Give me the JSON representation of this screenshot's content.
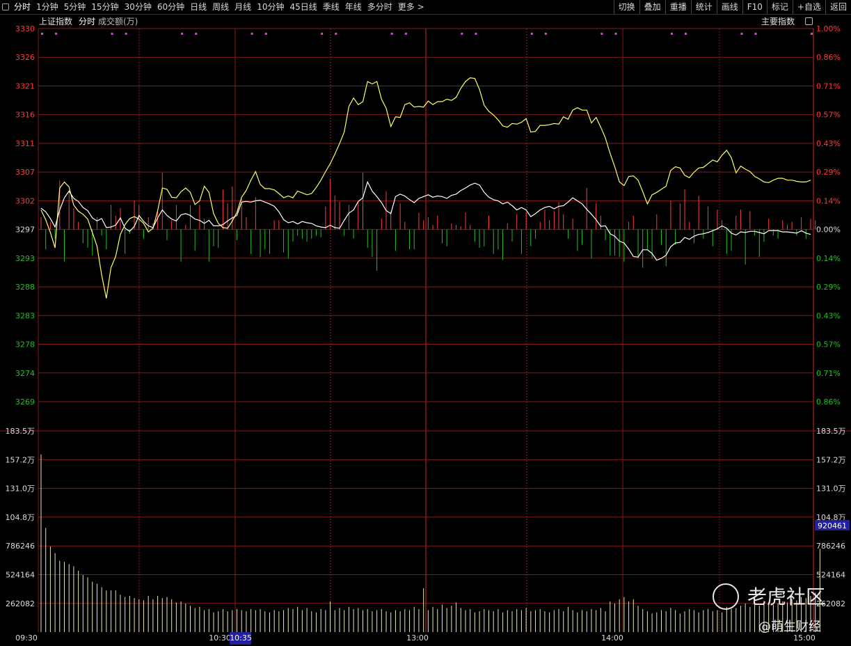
{
  "toolbar": {
    "left": [
      "分时",
      "1分钟",
      "5分钟",
      "15分钟",
      "30分钟",
      "60分钟",
      "日线",
      "周线",
      "月线",
      "10分钟",
      "45日线",
      "季线",
      "年线",
      "多分时",
      "更多 >"
    ],
    "right": [
      "切换",
      "叠加",
      "重播",
      "统计",
      "画线",
      "F10",
      "标记",
      "+自选",
      "返回"
    ]
  },
  "header": {
    "index_name": "上证指数",
    "mode": "分时",
    "volume_label": "成交额(万)",
    "main_index_button": "主要指数"
  },
  "colors": {
    "up": "#ff3b3b",
    "down": "#22c022",
    "grid": "#8a1a1a",
    "price": "#ffffff",
    "avg": "#ffff66",
    "signal": "#e040e0",
    "volume": "#e6e6b0",
    "highlight": "#2020a0"
  },
  "watermark": {
    "brand": "老虎社区",
    "author": "@萌生财经"
  },
  "chart_data": {
    "type": "line",
    "base_price": 3297,
    "price_axis": {
      "labels": [
        "3330",
        "3326",
        "3321",
        "3316",
        "3311",
        "3307",
        "3302",
        "3297",
        "3293",
        "3288",
        "3283",
        "3278",
        "3274",
        "3269"
      ],
      "pct": [
        "1.00%",
        "0.86%",
        "0.71%",
        "0.57%",
        "0.43%",
        "0.29%",
        "0.14%",
        "0.00%",
        "0.14%",
        "0.29%",
        "0.43%",
        "0.57%",
        "0.71%",
        "0.86%"
      ],
      "ylim": [
        3269,
        3330
      ]
    },
    "volume_axis": {
      "labels": [
        "183.5万",
        "157.2万",
        "131.0万",
        "104.8万",
        "786246",
        "524164",
        "262082"
      ],
      "ylim": [
        0,
        1835000
      ],
      "current_label": "920461"
    },
    "x_ticks": [
      "09:30",
      "10:30",
      "13:00",
      "14:00",
      "15:00"
    ],
    "cursor_time": "10:35",
    "series": [
      {
        "values": [
          3300.2,
          3298.6,
          3296.5,
          3294,
          3303.8,
          3304.8,
          3304,
          3301,
          3300,
          3299.5,
          3298.7,
          3296.5,
          3294.3,
          3289.6,
          3285.8,
          3290.8,
          3292.6,
          3296.2,
          3297.8,
          3298.8,
          3299.1,
          3298.7,
          3298,
          3296.6,
          3297.2,
          3300.1,
          3303.8,
          3303.6,
          3302.3,
          3302.2,
          3303.2,
          3303.8,
          3303.1,
          3301.1,
          3301.7,
          3304.1,
          3303.1,
          3299.6,
          3298,
          3297.3,
          3297.2,
          3298.4,
          3299.8,
          3302.3,
          3303.4,
          3305.1,
          3306.5,
          3304.4,
          3303.7,
          3303.7,
          3303.5,
          3302.9,
          3302.2,
          3302.5,
          3302.2,
          3303.3,
          3303,
          3302.7,
          3302.9,
          3303.9,
          3305.1,
          3306.5,
          3307.8,
          3309.4,
          3311.1,
          3313,
          3317.2,
          3318.6,
          3317.5,
          3318,
          3321.3,
          3320.9,
          3321.3,
          3318.4,
          3316.9,
          3313.9,
          3315.5,
          3315.4,
          3317.5,
          3317.8,
          3317.1,
          3317.2,
          3317.1,
          3318.1,
          3317.5,
          3318,
          3318,
          3318.4,
          3318.2,
          3318.7,
          3320.2,
          3321.3,
          3321.9,
          3321.8,
          3320,
          3317.4,
          3316.4,
          3315.8,
          3315,
          3314,
          3313.8,
          3314.4,
          3314.3,
          3314.6,
          3315.2,
          3313,
          3313.1,
          3314.1,
          3314.1,
          3314.2,
          3314.4,
          3314.3,
          3315.5,
          3315.1,
          3316.6,
          3317,
          3316.6,
          3316.6,
          3314.5,
          3315.4,
          3313.8,
          3312,
          3309.5,
          3307.3,
          3304.8,
          3304.2,
          3305.7,
          3305.8,
          3305.1,
          3303.2,
          3301.2,
          3302.7,
          3303.1,
          3303.6,
          3304.1,
          3306.7,
          3307.3,
          3307.1,
          3305.9,
          3305.5,
          3306.4,
          3307.1,
          3307.2,
          3307.8,
          3308.4,
          3308.1,
          3309.2,
          3310,
          3308.8,
          3306.3,
          3307.4,
          3306.9,
          3306.5,
          3305.7,
          3305.3,
          3304.8,
          3304.7,
          3305.1,
          3305.4,
          3305.4,
          3305.1,
          3305.1,
          3304.9,
          3304.8,
          3304.8,
          3305.1
        ]
      },
      {
        "values": [
          3300.5,
          3299.9,
          3298.8,
          3297.4,
          3300.2,
          3302.2,
          3303.3,
          3302.1,
          3301.6,
          3300.6,
          3300.1,
          3298.9,
          3298.4,
          3298.8,
          3297.3,
          3297.4,
          3297.7,
          3298.9,
          3297.2,
          3296.7,
          3297.5,
          3299.3,
          3298.3,
          3297.6,
          3297.3,
          3298.9,
          3300.2,
          3299.3,
          3298.7,
          3298.4,
          3299.4,
          3299.6,
          3299.3,
          3298.7,
          3298.5,
          3298,
          3298.5,
          3297.6,
          3297.6,
          3297.8,
          3298.4,
          3298.9,
          3299.3,
          3301.5,
          3301.6,
          3301.5,
          3301.7,
          3301.8,
          3301.5,
          3301.2,
          3300.8,
          3299.9,
          3298.6,
          3298.1,
          3298.3,
          3297.9,
          3298.3,
          3298.1,
          3298,
          3297.6,
          3297.4,
          3297.3,
          3297.7,
          3297.3,
          3297.2,
          3298.5,
          3299.7,
          3300.2,
          3301.6,
          3302.2,
          3304.8,
          3303.3,
          3302.4,
          3301.4,
          3300.1,
          3299.6,
          3302.4,
          3302.8,
          3302.5,
          3301.9,
          3301.4,
          3302.1,
          3302.4,
          3302.7,
          3302.3,
          3302.5,
          3302.4,
          3302.1,
          3302.6,
          3302.8,
          3303.4,
          3303.8,
          3304.3,
          3304.6,
          3304.3,
          3303.1,
          3302.3,
          3301.9,
          3301.7,
          3301.2,
          3301.5,
          3300.9,
          3300.2,
          3300.6,
          3300.2,
          3299.1,
          3299.6,
          3300.2,
          3300.6,
          3300.8,
          3300.4,
          3300.8,
          3300.9,
          3301.5,
          3302.2,
          3301.7,
          3301.2,
          3300.3,
          3299.5,
          3298.6,
          3297.5,
          3297.6,
          3296.3,
          3295.9,
          3295.1,
          3294.8,
          3293.8,
          3292.6,
          3292.5,
          3293.7,
          3293.7,
          3293.1,
          3292,
          3292.3,
          3292.8,
          3294.2,
          3294.8,
          3294.9,
          3295.7,
          3295.4,
          3295.9,
          3296.2,
          3296.3,
          3296.5,
          3296.8,
          3297.1,
          3297.6,
          3297.2,
          3296.4,
          3296.1,
          3296.6,
          3296.5,
          3296.7,
          3296.7,
          3296.5,
          3296.3,
          3296.8,
          3296.8,
          3296.8,
          3296.6,
          3296.6,
          3296.5,
          3296.4,
          3296.8,
          3296.4,
          3296.2
        ]
      },
      {
        "values": [
          0.8,
          -1.3,
          0.5,
          -0.6,
          3.2,
          -2.1,
          2.5,
          1.4,
          0.5,
          -0.9,
          -1.2,
          -1.7,
          0.8,
          -0.4,
          -1.3,
          1.6,
          0.9,
          1.4,
          -1.6,
          -0.3,
          1.9,
          1.6,
          -0.6,
          0.8,
          0.4,
          1.2,
          3.7,
          -0.7,
          0.6,
          1.6,
          -2.1,
          0.3,
          1.6,
          -1.4,
          1.6,
          0.7,
          -2.1,
          -1.1,
          -1.2,
          2.6,
          1.7,
          2.8,
          -0.7,
          2,
          0.8,
          -1.6,
          2.1,
          -1.8,
          -1.3,
          -1.6,
          0.6,
          0.6,
          -1.5,
          -1.9,
          -0.8,
          -0.4,
          -0.6,
          -0.8,
          -0.6,
          -0.4,
          -0.5,
          1.5,
          3.3,
          2.2,
          1.8,
          -0.4,
          1.6,
          -0.6,
          1.8,
          3.7,
          -1.2,
          -1.8,
          -2.7,
          0.7,
          2.5,
          1.2,
          -1.4,
          1.7,
          0.5,
          -1.3,
          -1.3,
          1.1,
          0.6,
          0.8,
          0.3,
          0.9,
          -0.9,
          -1.1,
          0.4,
          0.3,
          0.2,
          1.1,
          0.3,
          -0.8,
          -1.2,
          -1.1,
          0.9,
          -1.6,
          -1.3,
          -2,
          0.4,
          -0.8,
          1,
          -1.6,
          1.1,
          -1.1,
          -0.6,
          0.5,
          1.3,
          0.6,
          1.2,
          1.8,
          1,
          -0.6,
          0.7,
          -1.4,
          -1,
          2.7,
          -1.9,
          1.7,
          0.9,
          -0.7,
          -1.7,
          -1.7,
          -1.8,
          -2.1,
          0.5,
          0.9,
          -1.9,
          -2.5,
          -1.3,
          -1.9,
          1,
          -1,
          -2.4,
          1.9,
          -1,
          1.7,
          2.6,
          0.5,
          -0.9,
          2.2,
          -0.6,
          1.5,
          -1.1,
          1.3,
          0.6,
          -1.6,
          -1.4,
          0.9,
          1.3,
          -2.3,
          1.2,
          -0.4,
          -1.8,
          -0.8,
          0.7,
          -0.4,
          -0.6,
          0.6,
          0.3,
          0.5,
          -0.4,
          0.8,
          -0.6,
          0.7,
          0.6
        ]
      },
      {
        "values": [
          1620000,
          950000,
          780000,
          720000,
          650000,
          640000,
          620000,
          600000,
          560000,
          520000,
          500000,
          460000,
          440000,
          410000,
          380000,
          380000,
          380000,
          340000,
          320000,
          330000,
          310000,
          300000,
          290000,
          330000,
          300000,
          330000,
          310000,
          320000,
          300000,
          270000,
          280000,
          260000,
          240000,
          220000,
          230000,
          200000,
          210000,
          180000,
          190000,
          210000,
          190000,
          200000,
          210000,
          200000,
          190000,
          210000,
          200000,
          210000,
          190000,
          180000,
          200000,
          190000,
          200000,
          220000,
          210000,
          230000,
          200000,
          220000,
          190000,
          180000,
          210000,
          200000,
          280000,
          200000,
          220000,
          200000,
          230000,
          210000,
          220000,
          200000,
          210000,
          190000,
          200000,
          210000,
          190000,
          180000,
          200000,
          190000,
          210000,
          200000,
          230000,
          210000,
          400000,
          200000,
          230000,
          210000,
          250000,
          220000,
          240000,
          270000,
          220000,
          200000,
          210000,
          180000,
          190000,
          210000,
          200000,
          190000,
          210000,
          180000,
          200000,
          190000,
          210000,
          200000,
          220000,
          190000,
          200000,
          210000,
          190000,
          180000,
          200000,
          210000,
          190000,
          230000,
          200000,
          180000,
          200000,
          190000,
          210000,
          200000,
          220000,
          190000,
          280000,
          260000,
          300000,
          320000,
          280000,
          300000,
          240000,
          210000,
          190000,
          170000,
          180000,
          200000,
          190000,
          220000,
          200000,
          170000,
          190000,
          210000,
          200000,
          180000,
          200000,
          210000,
          190000,
          200000,
          180000,
          230000,
          210000,
          220000,
          240000,
          260000,
          230000,
          250000,
          240000,
          260000,
          270000,
          250000,
          260000,
          280000,
          270000,
          300000,
          290000,
          320000,
          310000,
          330000,
          360000,
          760000
        ]
      }
    ]
  }
}
